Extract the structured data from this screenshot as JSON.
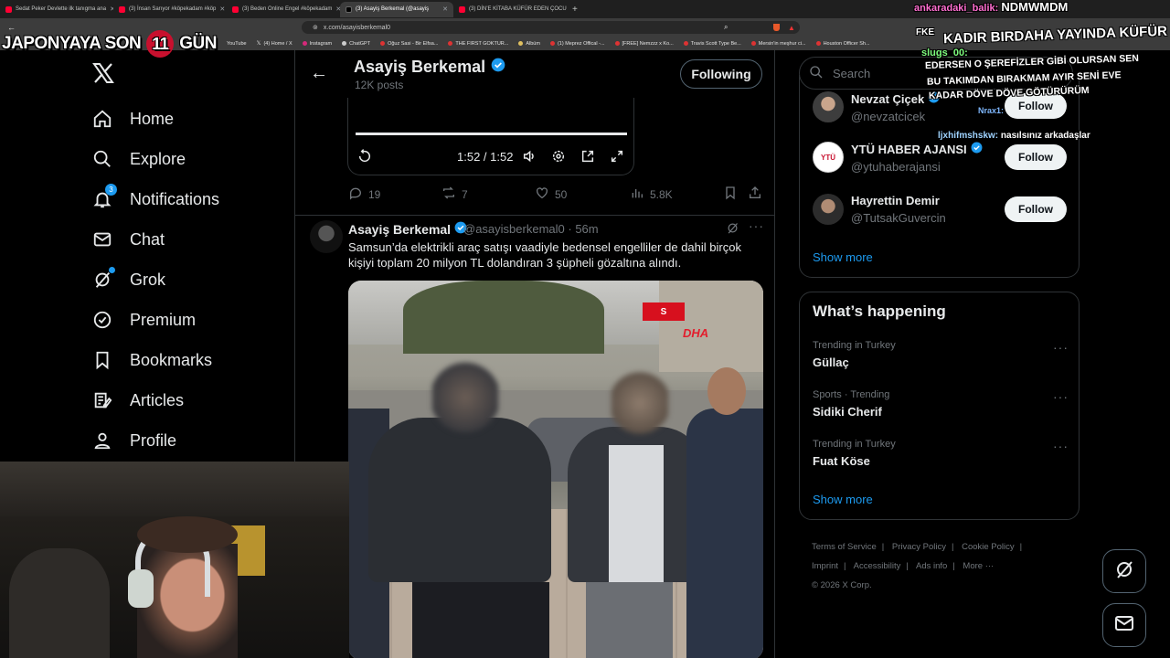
{
  "browser": {
    "tabs": [
      {
        "title": "Sedat Peker Devlette ilk tanıgma ana",
        "icon": "youtube-icon"
      },
      {
        "title": "(3) İnsan Sarıyor #köpekadam #köp",
        "icon": "youtube-icon"
      },
      {
        "title": "(3) Beden Online Engel #köpekadam",
        "icon": "youtube-icon"
      },
      {
        "title": "(3) Asayiş Berkemal (@asayiş",
        "icon": "x-icon",
        "active": true
      },
      {
        "title": "(3) DİN'E KİTABA KÜFÜR EDEN ÇOCU",
        "icon": "youtube-icon"
      }
    ],
    "url": "x.com/asayisberkemal0",
    "bookmarks": [
      "YouTube",
      "(4) Home / X",
      "Instagram",
      "ChatGPT",
      "Oğuz Sasi - Bir Elfsa...",
      "THE FIRST GOKTUR...",
      "Albüm",
      "(1) Meprez Offical -...",
      "[FREE] Nemzzz x Ko...",
      "Travis Scott Type Be...",
      "Mersin'in meşhur ci...",
      "Houston Officer Sh..."
    ]
  },
  "overlay": {
    "banner_left": "JAPONYAYA SON",
    "banner_number": "11",
    "banner_right": "GÜN",
    "chat": [
      {
        "user": "ankaradaki_balik:",
        "text": "NDMWMDM"
      },
      {
        "user": "",
        "text": "FKE"
      },
      {
        "user": "",
        "text": "KADIR BIRDAHA YAYINDA KÜFÜR"
      },
      {
        "user": "slugs_00:",
        "text": ""
      },
      {
        "user": "",
        "text": "EDERSEN O ŞEREFİZLER GİBİ OLURSAN SEN"
      },
      {
        "user": "",
        "text": "BU TAKIMDAN BIRAKMAM AYIR SENİ EVE"
      },
      {
        "user": "",
        "text": "KADAR DÖVE DÖVE GÖTÜRÜRÜM"
      },
      {
        "user": "Nrax1:",
        "text": ""
      },
      {
        "user": "ljxhifmshskw:",
        "text": "nasılsınız arkadaşlar"
      }
    ]
  },
  "nav": {
    "items": [
      {
        "label": "Home",
        "icon": "home-icon"
      },
      {
        "label": "Explore",
        "icon": "search-icon"
      },
      {
        "label": "Notifications",
        "icon": "bell-icon",
        "badge": "3"
      },
      {
        "label": "Chat",
        "icon": "mail-icon"
      },
      {
        "label": "Grok",
        "icon": "grok-icon"
      },
      {
        "label": "Premium",
        "icon": "premium-icon"
      },
      {
        "label": "Bookmarks",
        "icon": "bookmark-icon"
      },
      {
        "label": "Articles",
        "icon": "articles-icon"
      },
      {
        "label": "Profile",
        "icon": "profile-icon"
      }
    ]
  },
  "header": {
    "name": "Asayiş Berkemal",
    "posts": "12K posts",
    "following_label": "Following"
  },
  "video": {
    "time": "1:52 / 1:52"
  },
  "tweet1": {
    "replies": "19",
    "reposts": "7",
    "likes": "50",
    "views": "5.8K"
  },
  "tweet2": {
    "name": "Asayiş Berkemal",
    "handle": "@asayisberkemal0",
    "time": "· 56m",
    "text": "Samsun’da elektrikli araç satışı vaadiyle bedensel engelliler de dahil birçok kişiyi toplam 20 milyon TL dolandıran 3 şüpheli gözaltına alındı.",
    "media_badge": "S",
    "media_logo": "DHA"
  },
  "sidebar": {
    "search_placeholder": "Search",
    "who_to_follow": [
      {
        "name": "Nevzat Çiçek",
        "handle": "@nevzatcicek",
        "verified": true,
        "button": "Follow"
      },
      {
        "name": "YTÜ HABER AJANSI",
        "handle": "@ytuhaberajansi",
        "verified": true,
        "button": "Follow"
      },
      {
        "name": "Hayrettin Demir",
        "handle": "@TutsakGuvercin",
        "verified": false,
        "button": "Follow"
      }
    ],
    "show_more": "Show more",
    "happening_title": "What’s happening",
    "trends": [
      {
        "meta": "Trending in Turkey",
        "title": "Güllaç"
      },
      {
        "meta": "Sports · Trending",
        "title": "Sidiki Cherif"
      },
      {
        "meta": "Trending in Turkey",
        "title": "Fuat Köse"
      }
    ],
    "happening_show_more": "Show more",
    "footer": [
      "Terms of Service",
      "|",
      "Privacy Policy",
      "|",
      "Cookie Policy",
      "|",
      "Imprint",
      "|",
      "Accessibility",
      "|",
      "Ads info",
      "|",
      "More ···"
    ],
    "copyright": "© 2026 X Corp."
  },
  "colors": {
    "accent": "#1d9bf0",
    "background": "#000000",
    "border": "#2f3336",
    "muted": "#71767b",
    "banner_red": "#c8102e"
  }
}
